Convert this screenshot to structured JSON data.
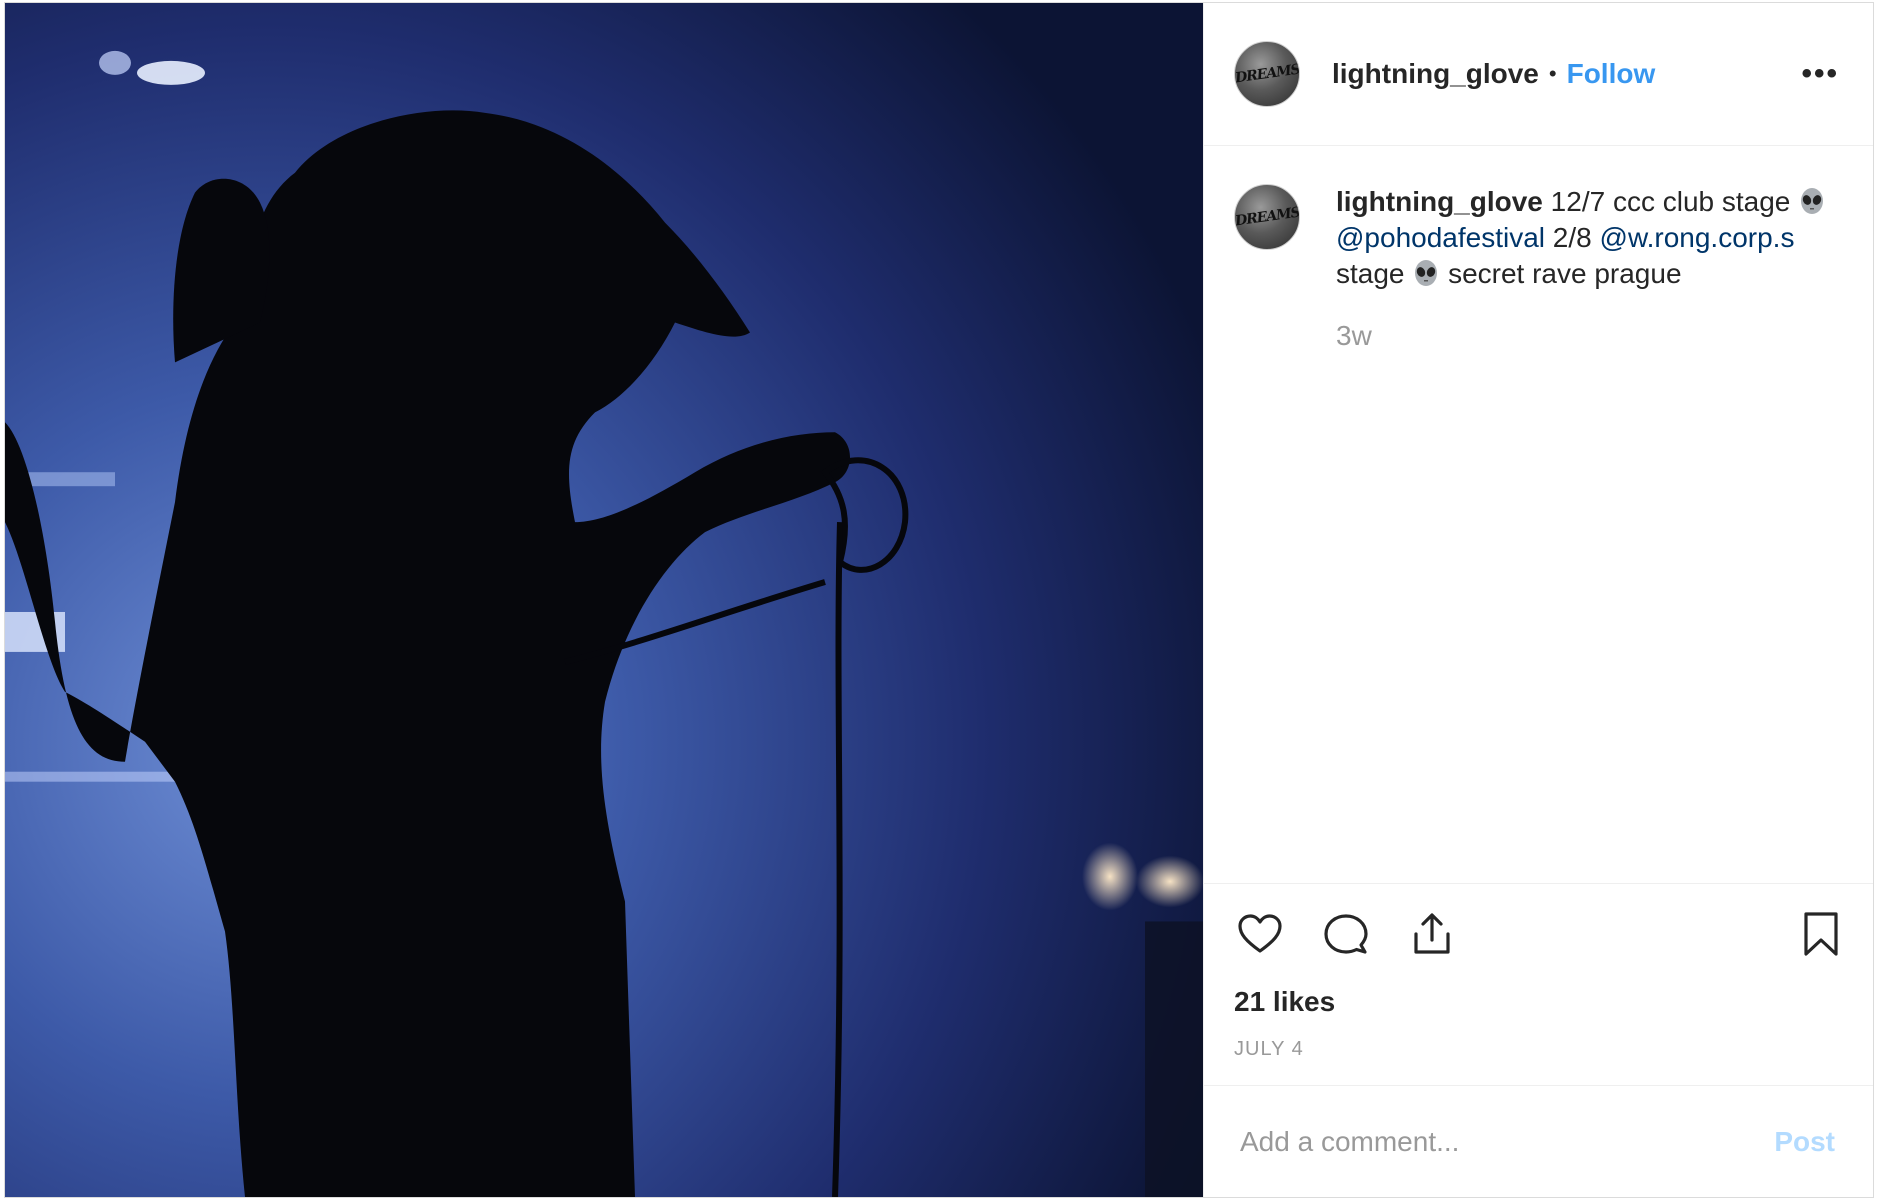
{
  "post": {
    "username": "lightning_glove",
    "separator": "•",
    "follow_label": "Follow",
    "more_label": "•••",
    "avatar_text": "DREAMS",
    "caption": {
      "username": "lightning_glove",
      "part1": "12/7 ccc club stage",
      "mention1": "@pohodafestival",
      "part2": "2/8",
      "mention2": "@w.rong.corp.s",
      "part3": "stage",
      "part4": "secret rave prague",
      "emoji": "alien-emoji"
    },
    "caption_time": "3w",
    "likes": "21 likes",
    "date": "JULY 4",
    "comment_placeholder": "Add a comment...",
    "post_label": "Post"
  },
  "icons": [
    "heart-icon",
    "comment-icon",
    "share-icon",
    "bookmark-icon"
  ],
  "colors": {
    "accent": "#3897f0",
    "mention": "#003569",
    "muted": "#999999",
    "post_disabled": "#b3dbff",
    "text": "#262626"
  }
}
